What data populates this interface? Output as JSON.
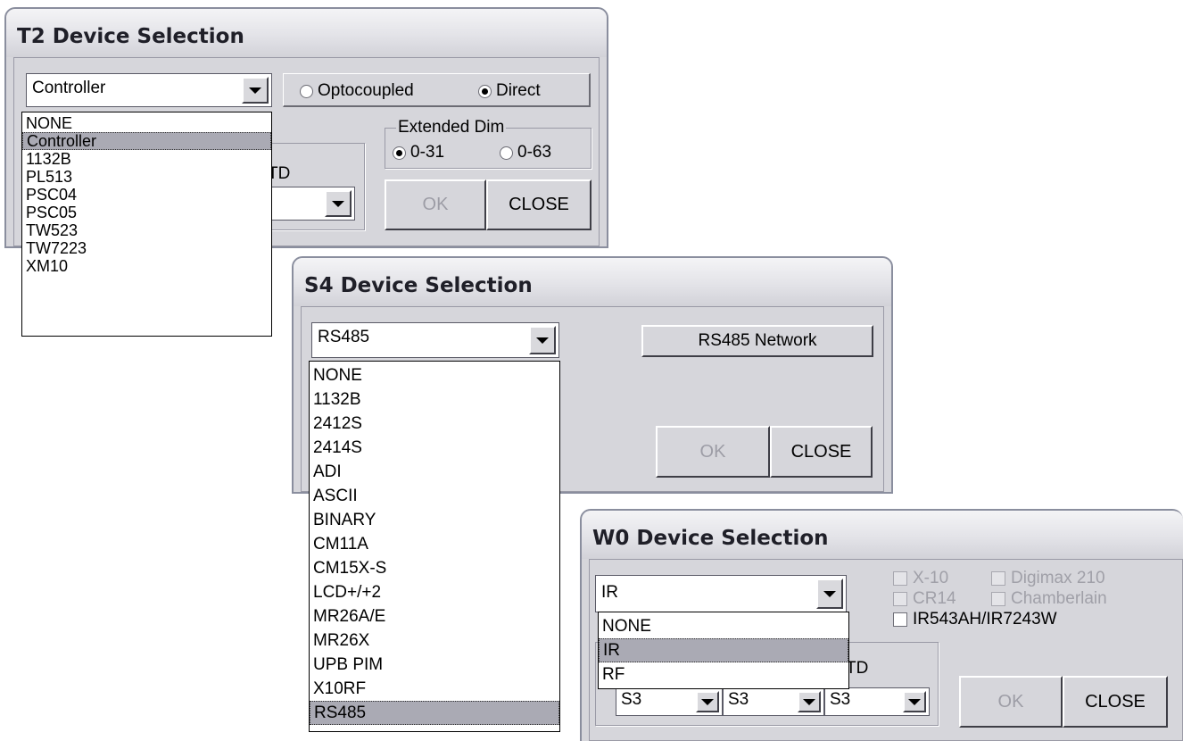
{
  "t2": {
    "title": "T2 Device Selection",
    "device_value": "Controller",
    "radio_optocoupled": "Optocoupled",
    "radio_direct": "Direct",
    "extended_dim_label": "Extended Dim",
    "ext_0_31": "0-31",
    "ext_0_63": "0-63",
    "group_partial_label": "TD",
    "ok_label": "OK",
    "close_label": "CLOSE",
    "list_items": [
      "NONE",
      "Controller",
      "1132B",
      "PL513",
      "PSC04",
      "PSC05",
      "TW523",
      "TW7223",
      "XM10"
    ],
    "selected_index": 1
  },
  "s4": {
    "title": "S4 Device Selection",
    "device_value": "RS485",
    "network_button": "RS485 Network",
    "ok_label": "OK",
    "close_label": "CLOSE",
    "list_items": [
      "NONE",
      "1132B",
      "2412S",
      "2414S",
      "ADI",
      "ASCII",
      "BINARY",
      "CM11A",
      "CM15X-S",
      "LCD+/+2",
      "MR26A/E",
      "MR26X",
      "UPB PIM",
      "X10RF",
      "RS485"
    ],
    "selected_index": 14
  },
  "w0": {
    "title": "W0 Device Selection",
    "device_value": "IR",
    "check_x10": "X-10",
    "check_digimax": "Digimax 210",
    "check_cr14": "CR14",
    "check_chamberlain": "Chamberlain",
    "check_ir543": "IR543AH/IR7243W",
    "group_partial_label": "TD",
    "combo1": "S3",
    "combo2": "S3",
    "combo3": "S3",
    "ok_label": "OK",
    "close_label": "CLOSE",
    "list_items": [
      "NONE",
      "IR",
      "RF"
    ],
    "selected_index": 1
  }
}
